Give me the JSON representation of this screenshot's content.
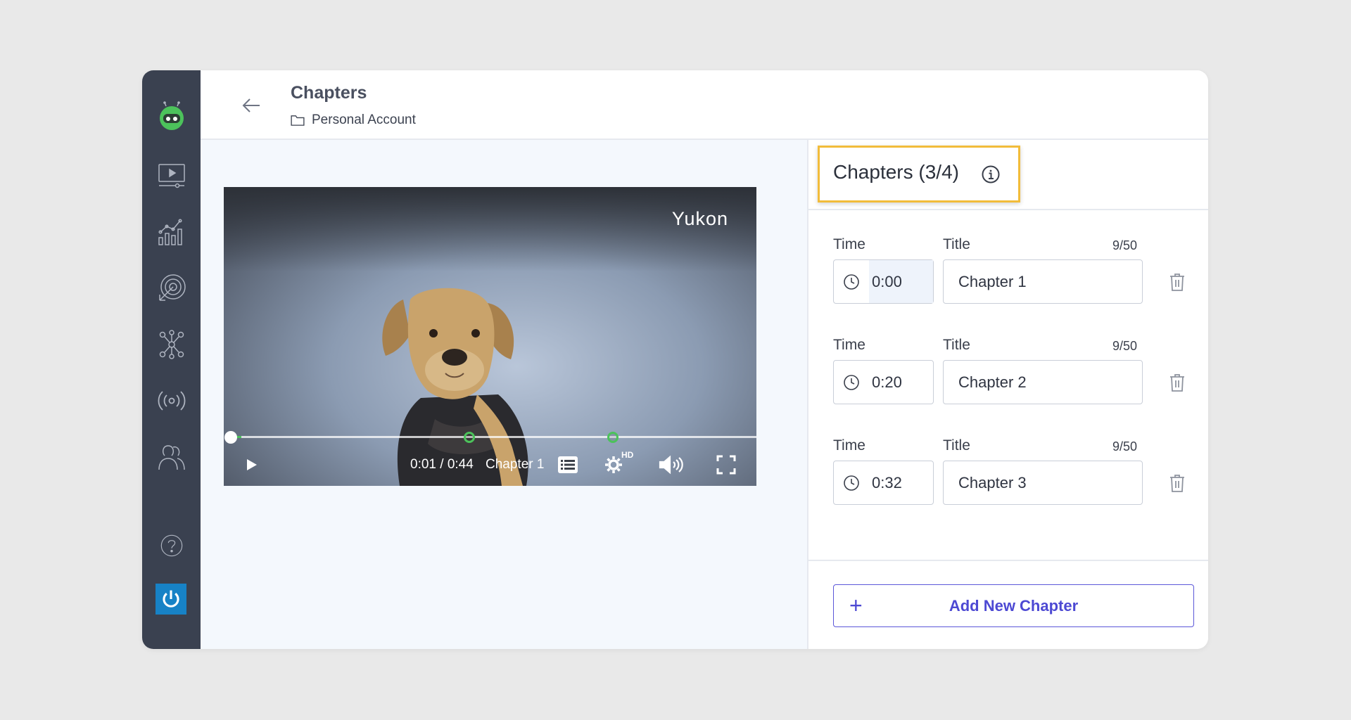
{
  "header": {
    "title": "Chapters",
    "breadcrumb": "Personal Account"
  },
  "video": {
    "title": "Yukon",
    "time_display": "0:01 / 0:44",
    "current_chapter": "Chapter 1",
    "quality_badge": "HD",
    "progress_fraction": 0.023,
    "chapter_marker_fractions": [
      0.455,
      0.728
    ]
  },
  "panel": {
    "title": "Chapters (3/4)",
    "time_label": "Time",
    "title_label": "Title",
    "chapters": [
      {
        "time": "0:00",
        "title": "Chapter 1",
        "counter": "9/50"
      },
      {
        "time": "0:20",
        "title": "Chapter 2",
        "counter": "9/50"
      },
      {
        "time": "0:32",
        "title": "Chapter 3",
        "counter": "9/50"
      }
    ],
    "add_button": "Add New Chapter"
  },
  "colors": {
    "sidebar": "#3a4150",
    "accent": "#4d49d3",
    "highlight": "#f2bc3a",
    "progress": "#4cc25b",
    "logo_green": "#4cc25b",
    "power_blue": "#1782c6"
  },
  "icons": {
    "sidebar": [
      "logo-robot-icon",
      "video-library-icon",
      "analytics-icon",
      "target-icon",
      "integrations-icon",
      "live-broadcast-icon",
      "users-icon",
      "help-icon",
      "power-icon"
    ]
  }
}
